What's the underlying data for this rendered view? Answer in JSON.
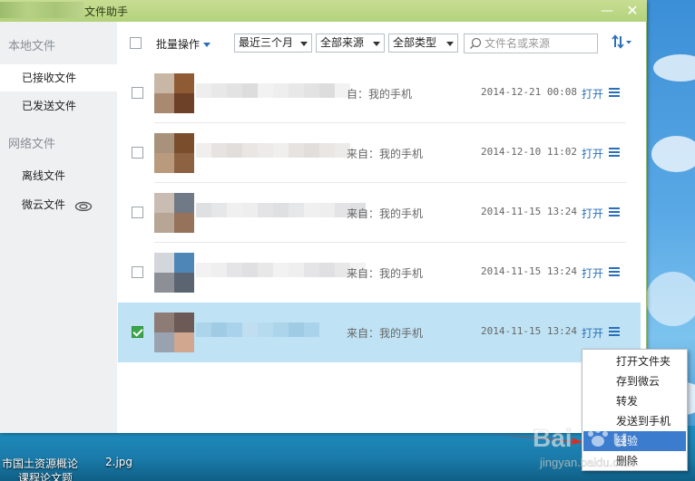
{
  "window": {
    "title": "文件助手",
    "minimize_glyph": "—",
    "close_glyph": "✕"
  },
  "sidebar": {
    "local_header": "本地文件",
    "received": "已接收文件",
    "sent": "已发送文件",
    "network_header": "网络文件",
    "offline": "离线文件",
    "weiyun": "微云文件"
  },
  "toolbar": {
    "batch": "批量操作",
    "filters": [
      "最近三个月",
      "全部来源",
      "全部类型"
    ],
    "search_placeholder": "文件名或来源"
  },
  "rows": [
    {
      "source": "自：我的手机",
      "date": "2014-12-21 00:08",
      "open": "打开",
      "checked": false
    },
    {
      "source": "来自：我的手机",
      "date": "2014-12-10 11:02",
      "open": "打开",
      "checked": false
    },
    {
      "source": "来自：我的手机",
      "date": "2014-11-15 13:24",
      "open": "打开",
      "checked": false
    },
    {
      "source": "来自：我的手机",
      "date": "2014-11-15 13:24",
      "open": "打开",
      "checked": false
    },
    {
      "source": "来自：我的手机",
      "date": "2014-11-15 13:24",
      "open": "打开",
      "checked": true
    }
  ],
  "context_menu": {
    "items": [
      "打开文件夹",
      "存到微云",
      "转发",
      "发送到手机",
      "经验",
      "删除"
    ],
    "highlighted": "经验"
  },
  "desktop": {
    "file1": "市国土资源概论",
    "file2": "2.jpg",
    "file3": "课程论文题"
  },
  "colors": {
    "accent": "#2a6fb8",
    "titlebar": "#b3d27a",
    "selected_row": "#bfe3f5",
    "menu_highlight": "#3b7ccf"
  }
}
